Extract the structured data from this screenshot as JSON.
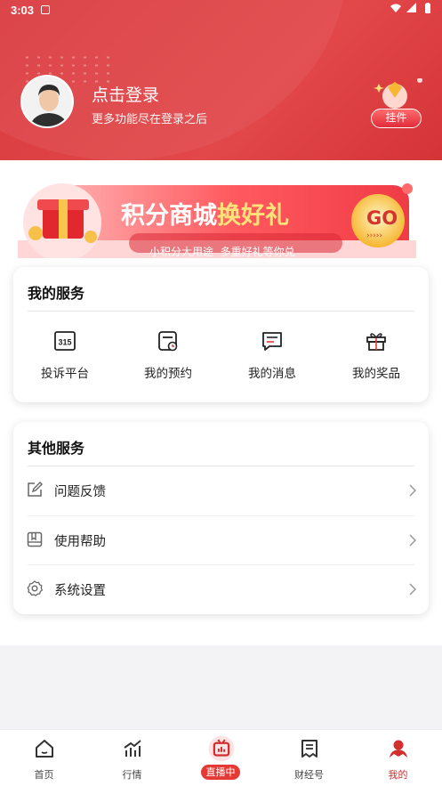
{
  "status": {
    "time": "3:03"
  },
  "header": {
    "login_title": "点击登录",
    "login_subtitle": "更多功能尽在登录之后",
    "pendant_label": "挂件"
  },
  "banner": {
    "title_part1": "积分商城",
    "title_part2": "换好礼",
    "subtitle": "小积分大用途  多重好礼等你兑",
    "go_label": "GO",
    "arrows": "›››››"
  },
  "my_services": {
    "title": "我的服务",
    "items": [
      {
        "label": "投诉平台",
        "icon": "315-icon"
      },
      {
        "label": "我的预约",
        "icon": "calendar-clock-icon"
      },
      {
        "label": "我的消息",
        "icon": "message-icon"
      },
      {
        "label": "我的奖品",
        "icon": "gift-icon"
      }
    ]
  },
  "other_services": {
    "title": "其他服务",
    "items": [
      {
        "label": "问题反馈",
        "icon": "edit-icon"
      },
      {
        "label": "使用帮助",
        "icon": "help-book-icon"
      },
      {
        "label": "系统设置",
        "icon": "gear-icon"
      }
    ]
  },
  "bottom_nav": {
    "items": [
      {
        "label": "首页",
        "icon": "home-icon"
      },
      {
        "label": "行情",
        "icon": "market-chart-icon"
      },
      {
        "label": "直播中",
        "icon": "live-tv-icon"
      },
      {
        "label": "财经号",
        "icon": "finance-doc-icon"
      },
      {
        "label": "我的",
        "icon": "user-icon"
      }
    ],
    "active": "我的"
  },
  "colors": {
    "brand_red": "#e0393d",
    "active_nav": "#d32f2f"
  }
}
